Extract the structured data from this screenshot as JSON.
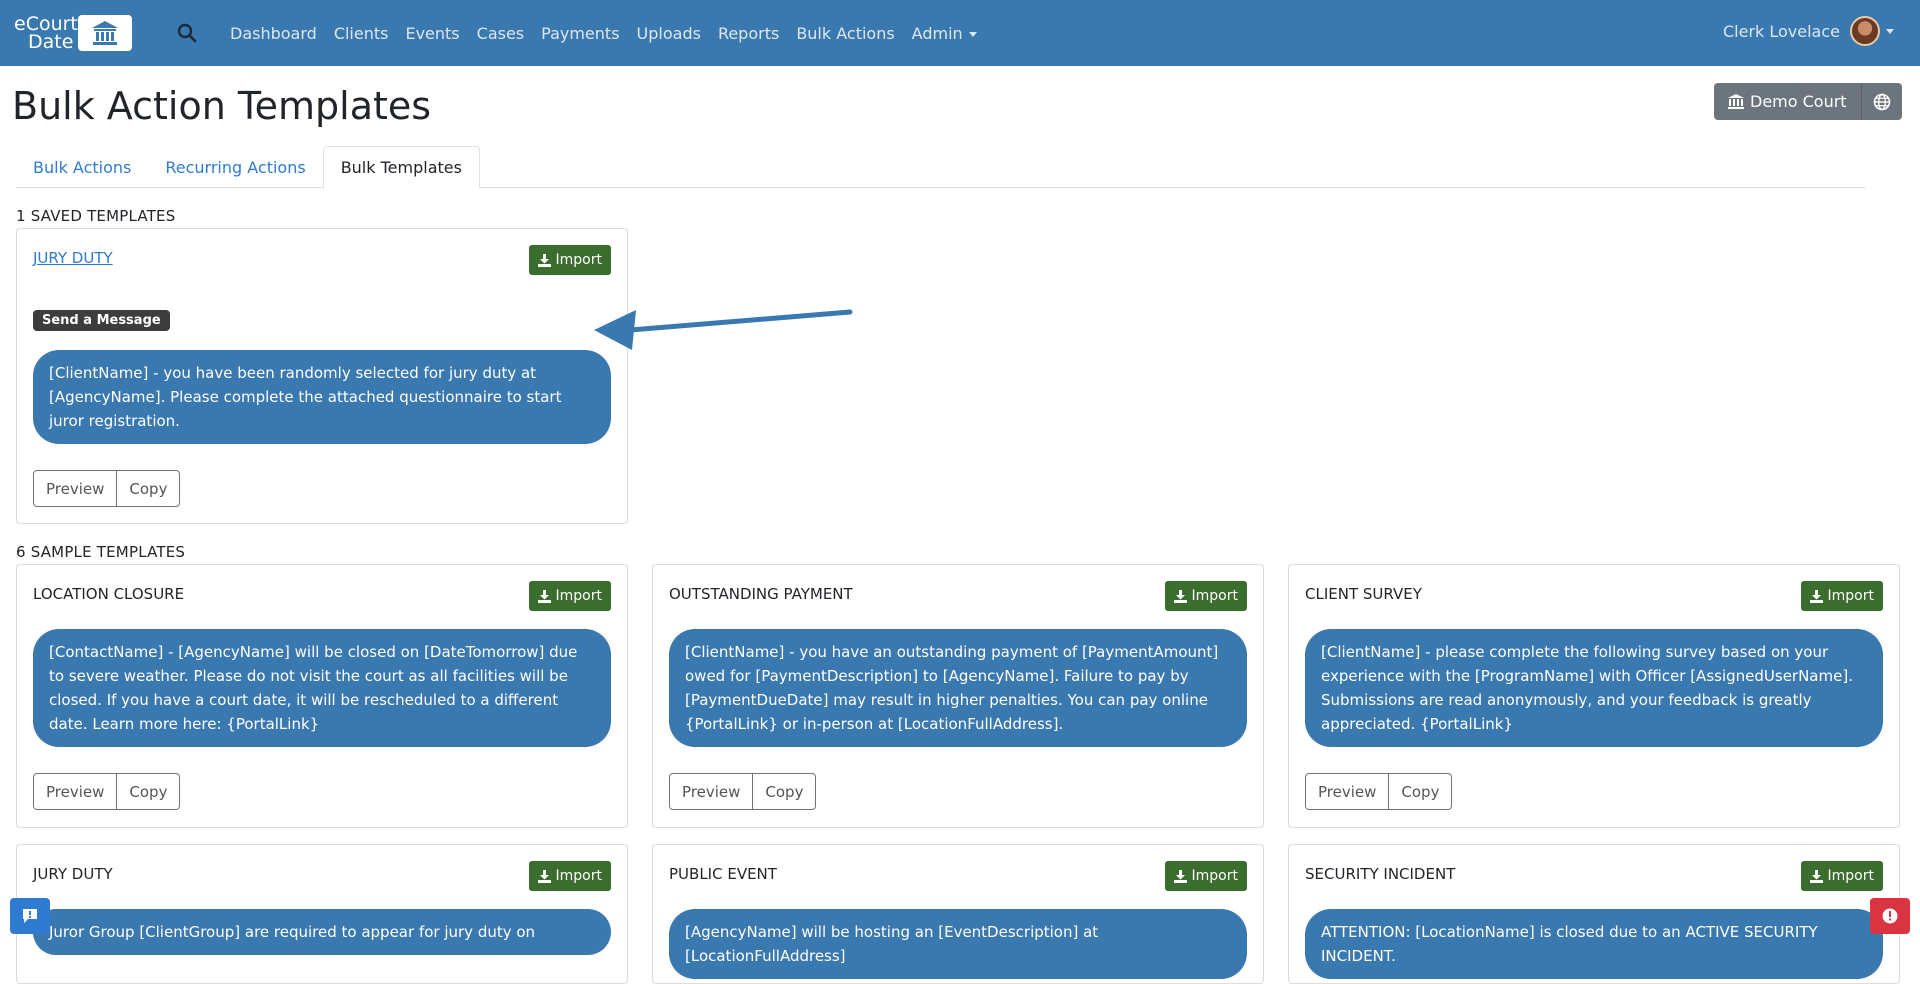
{
  "navbar": {
    "logo_line1": "eCourt",
    "logo_line2": "Date",
    "links": [
      "Dashboard",
      "Clients",
      "Events",
      "Cases",
      "Payments",
      "Uploads",
      "Reports",
      "Bulk Actions",
      "Admin"
    ],
    "user_name": "Clerk Lovelace"
  },
  "header": {
    "title": "Bulk Action Templates",
    "court_button": "Demo Court"
  },
  "tabs": [
    {
      "label": "Bulk Actions",
      "active": false
    },
    {
      "label": "Recurring Actions",
      "active": false
    },
    {
      "label": "Bulk Templates",
      "active": true
    }
  ],
  "saved": {
    "heading": "1 SAVED TEMPLATES",
    "cards": [
      {
        "title": "JURY DUTY",
        "import_label": "Import",
        "badge": "Send a Message",
        "message": "[ClientName] - you have been randomly selected for jury duty at [AgencyName]. Please complete the attached questionnaire to start juror registration.",
        "preview_label": "Preview",
        "copy_label": "Copy"
      }
    ]
  },
  "samples": {
    "heading": "6 SAMPLE TEMPLATES",
    "cards": [
      {
        "title": "LOCATION CLOSURE",
        "import_label": "Import",
        "message": "[ContactName] - [AgencyName] will be closed on [DateTomorrow] due to severe weather. Please do not visit the court as all facilities will be closed. If you have a court date, it will be rescheduled to a different date. Learn more here: {PortalLink}",
        "preview_label": "Preview",
        "copy_label": "Copy"
      },
      {
        "title": "OUTSTANDING PAYMENT",
        "import_label": "Import",
        "message": "[ClientName] - you have an outstanding payment of [PaymentAmount] owed for [PaymentDescription] to [AgencyName]. Failure to pay by [PaymentDueDate] may result in higher penalties. You can pay online {PortalLink} or in-person at [LocationFullAddress].",
        "preview_label": "Preview",
        "copy_label": "Copy"
      },
      {
        "title": "CLIENT SURVEY",
        "import_label": "Import",
        "message": "[ClientName] - please complete the following survey based on your experience with the [ProgramName] with Officer [AssignedUserName]. Submissions are read anonymously, and your feedback is greatly appreciated. {PortalLink}",
        "preview_label": "Preview",
        "copy_label": "Copy"
      },
      {
        "title": "JURY DUTY",
        "import_label": "Import",
        "message": "Juror Group [ClientGroup] are required to appear for jury duty on"
      },
      {
        "title": "PUBLIC EVENT",
        "import_label": "Import",
        "message": "[AgencyName] will be hosting an [EventDescription] at [LocationFullAddress]"
      },
      {
        "title": "SECURITY INCIDENT",
        "import_label": "Import",
        "message": "ATTENTION: [LocationName] is closed due to an ACTIVE SECURITY INCIDENT."
      }
    ]
  },
  "colors": {
    "navbar": "#3a78b0",
    "bubble": "#3a78b0",
    "import": "#3b6e2e",
    "link": "#2f7bd1"
  }
}
